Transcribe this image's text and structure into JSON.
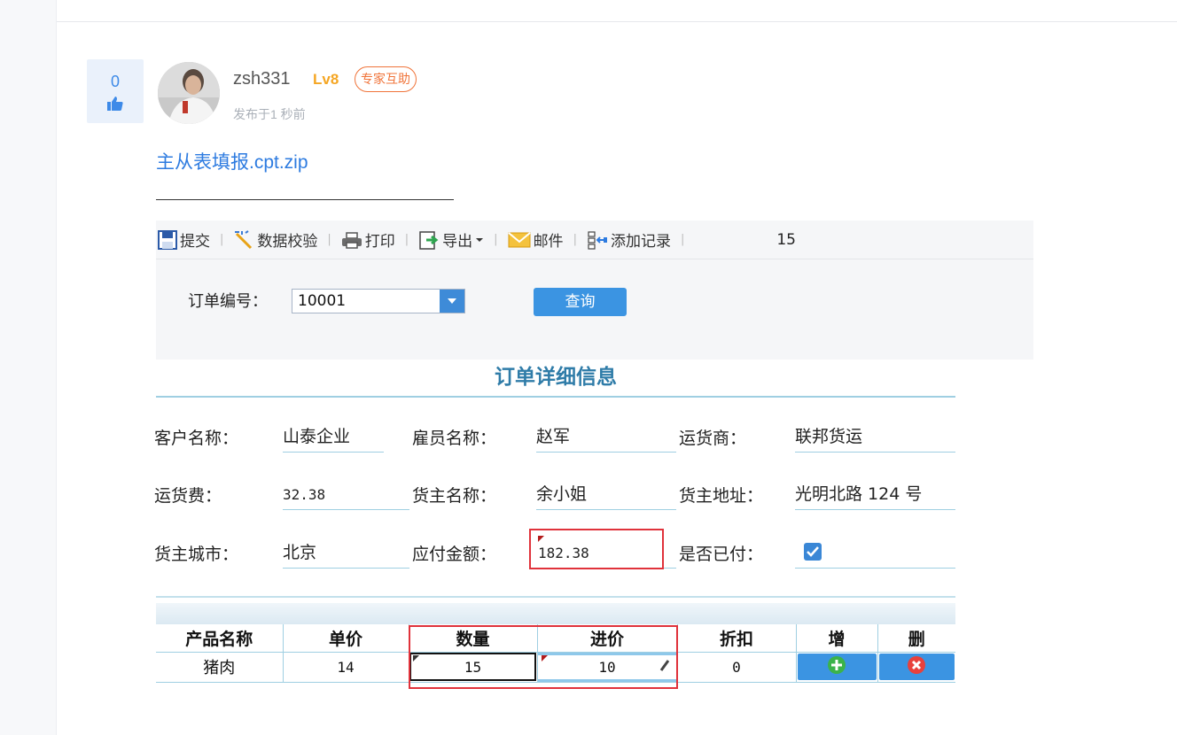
{
  "post": {
    "vote_count": "0",
    "username": "zsh331",
    "level": "Lv8",
    "badge": "专家互助",
    "time": "发布于1 秒前",
    "attachment": "主从表填报.cpt.zip"
  },
  "toolbar": {
    "submit": "提交",
    "validate": "数据校验",
    "print": "打印",
    "export": "导出",
    "mail": "邮件",
    "add_record": "添加记录",
    "counter": "15"
  },
  "params": {
    "order_label": "订单编号：",
    "order_value": "10001",
    "query_label": "查询"
  },
  "form": {
    "title": "订单详细信息",
    "customer_label": "客户名称：",
    "customer_value": "山泰企业",
    "employee_label": "雇员名称：",
    "employee_value": "赵军",
    "shipper_label": "运货商：",
    "shipper_value": "联邦货运",
    "freight_label": "运货费：",
    "freight_value": "32.38",
    "consignee_label": "货主名称：",
    "consignee_value": "余小姐",
    "address_label": "货主地址：",
    "address_value": "光明北路 124 号",
    "city_label": "货主城市：",
    "city_value": "北京",
    "amount_label": "应付金额：",
    "amount_value": "182.38",
    "paid_label": "是否已付：",
    "paid_checked": true
  },
  "detail_table": {
    "headers": [
      "产品名称",
      "单价",
      "数量",
      "进价",
      "折扣",
      "增",
      "删"
    ],
    "rows": [
      {
        "product": "猪肉",
        "price": "14",
        "qty": "15",
        "cost": "10",
        "discount": "0"
      }
    ]
  },
  "colors": {
    "link": "#2d7be0",
    "level": "#f5a623",
    "badge": "#f0743a",
    "accent": "#3b94e2",
    "title": "#2f7ca8",
    "highlight": "#e0323b"
  }
}
